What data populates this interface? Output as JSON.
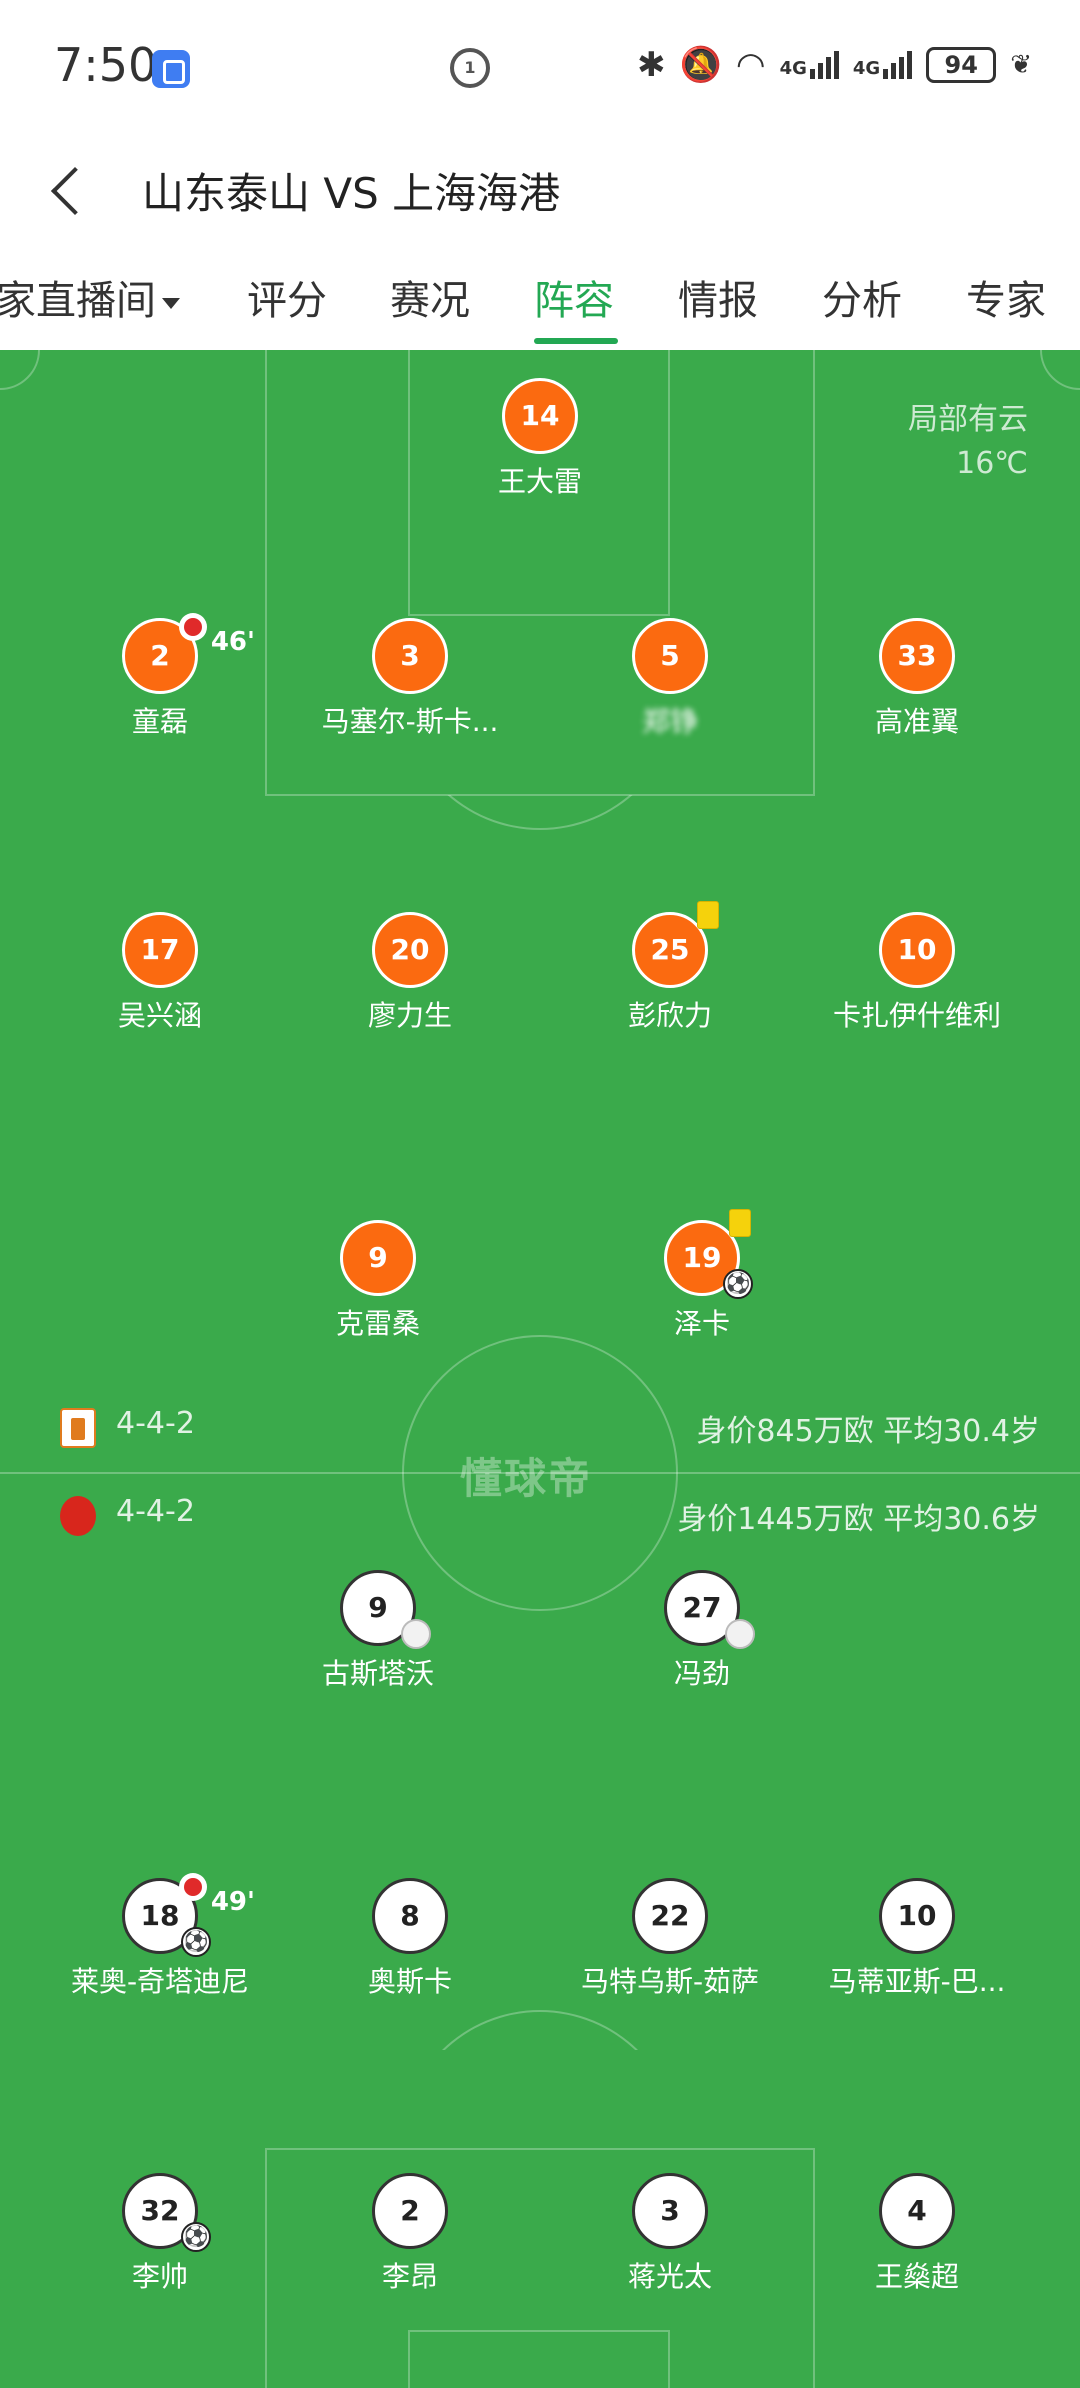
{
  "status_bar": {
    "time": "7:50",
    "battery": "94",
    "net1": "4G",
    "net2": "4G"
  },
  "nav": {
    "title": "山东泰山 VS 上海海港"
  },
  "tabs": [
    {
      "label": "家直播间",
      "active": false
    },
    {
      "label": "评分",
      "active": false
    },
    {
      "label": "赛况",
      "active": false
    },
    {
      "label": "阵容",
      "active": true
    },
    {
      "label": "情报",
      "active": false
    },
    {
      "label": "分析",
      "active": false
    },
    {
      "label": "专家",
      "active": false
    }
  ],
  "weather": {
    "condition": "局部有云",
    "temp": "16℃"
  },
  "watermark": "懂球帝",
  "home_team": {
    "formation": "4-4-2",
    "stats": "身价845万欧   平均30.4岁",
    "color": "#fb6a10",
    "players": {
      "gk": {
        "number": "14",
        "name": "王大雷"
      },
      "d1": {
        "number": "2",
        "name": "童磊",
        "sub_minute": "46'"
      },
      "d2": {
        "number": "3",
        "name": "马塞尔-斯卡..."
      },
      "d3": {
        "number": "5",
        "name": "郑铮"
      },
      "d4": {
        "number": "33",
        "name": "高准翼"
      },
      "m1": {
        "number": "17",
        "name": "吴兴涵"
      },
      "m2": {
        "number": "20",
        "name": "廖力生"
      },
      "m3": {
        "number": "25",
        "name": "彭欣力"
      },
      "m4": {
        "number": "10",
        "name": "卡扎伊什维利"
      },
      "f1": {
        "number": "9",
        "name": "克雷桑"
      },
      "f2": {
        "number": "19",
        "name": "泽卡"
      }
    }
  },
  "away_team": {
    "formation": "4-4-2",
    "stats": "身价1445万欧 平均30.6岁",
    "players": {
      "f1": {
        "number": "9",
        "name": "古斯塔沃"
      },
      "f2": {
        "number": "27",
        "name": "冯劲"
      },
      "m1": {
        "number": "18",
        "name": "莱奥-奇塔迪尼",
        "sub_minute": "49'"
      },
      "m2": {
        "number": "8",
        "name": "奥斯卡"
      },
      "m3": {
        "number": "22",
        "name": "马特乌斯-茹萨"
      },
      "m4": {
        "number": "10",
        "name": "马蒂亚斯-巴..."
      },
      "d1": {
        "number": "32",
        "name": "李帅"
      },
      "d2": {
        "number": "2",
        "name": "李昂"
      },
      "d3": {
        "number": "3",
        "name": "蒋光太"
      },
      "d4": {
        "number": "4",
        "name": "王燊超"
      }
    }
  }
}
